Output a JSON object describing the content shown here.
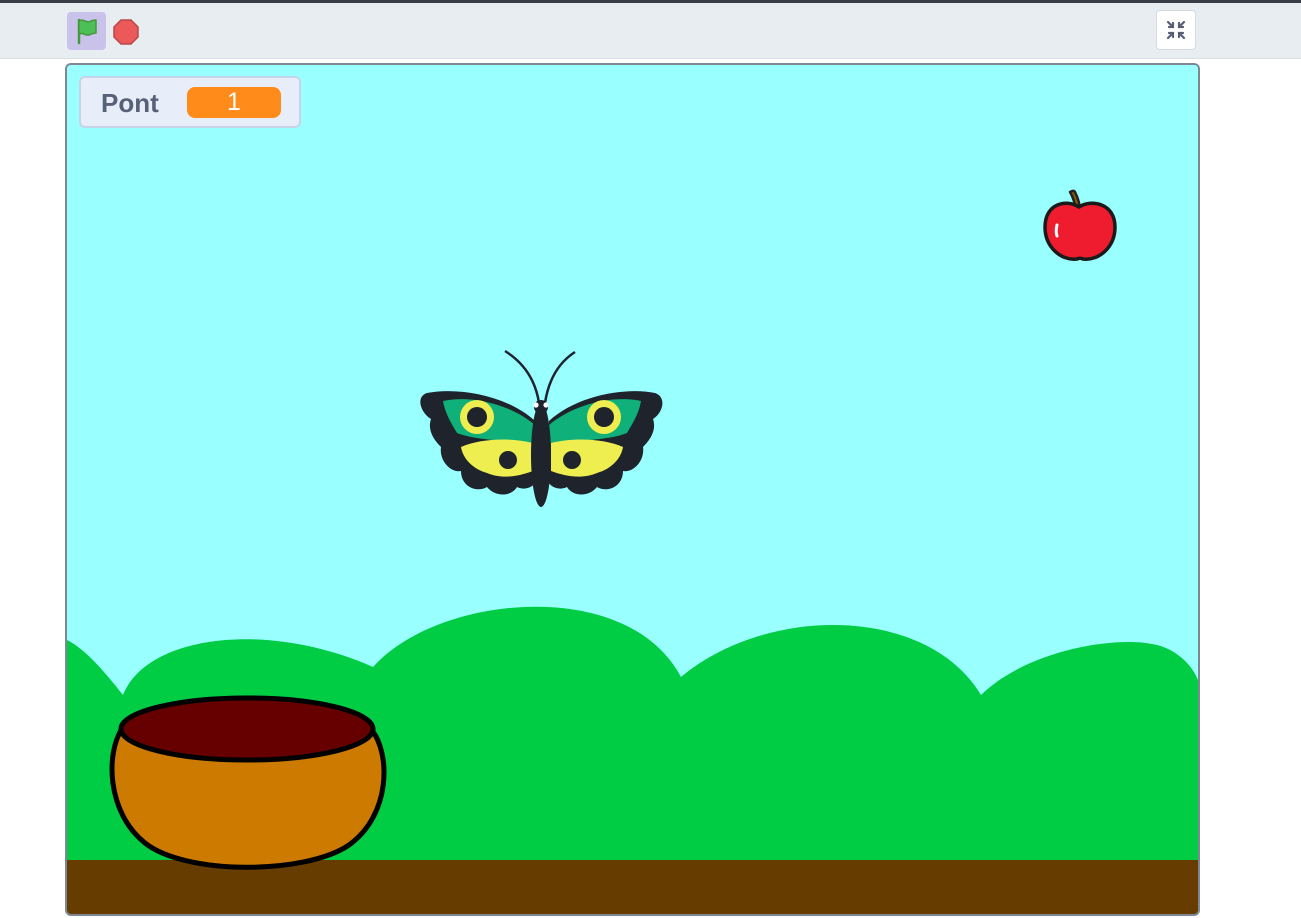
{
  "toolbar": {
    "green_flag": "green-flag-icon",
    "stop": "stop-sign-icon",
    "fullscreen": "exit-fullscreen-icon"
  },
  "stage": {
    "variable_monitor": {
      "label": "Pont",
      "value": "1"
    },
    "sprites": [
      "butterfly",
      "apple",
      "bowl"
    ],
    "colors": {
      "sky": "#99ffff",
      "hills": "#00cc44",
      "ground": "#663c00",
      "monitor_value_bg": "#ff8c1a"
    }
  }
}
